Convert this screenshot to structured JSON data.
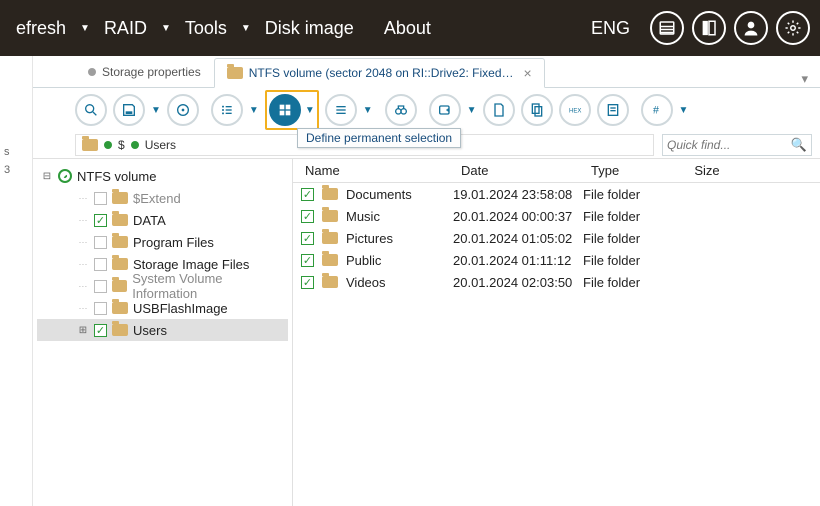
{
  "menubar": {
    "items": [
      "efresh",
      "RAID",
      "Tools",
      "Disk image",
      "About"
    ],
    "lang": "ENG"
  },
  "tabs": {
    "inactive_label": "Storage properties",
    "active_label": "NTFS volume (sector 2048 on RI::Drive2: Fixed…"
  },
  "tooltip": "Define permanent selection",
  "crumb": {
    "sep": "$",
    "tail": "Users"
  },
  "quickfind_placeholder": "Quick find...",
  "tree": {
    "root": "NTFS volume",
    "items": [
      {
        "label": "$Extend",
        "grey": true
      },
      {
        "label": "DATA",
        "checked": true
      },
      {
        "label": "Program Files"
      },
      {
        "label": "Storage Image Files"
      },
      {
        "label": "System Volume Information",
        "grey": true
      },
      {
        "label": "USBFlashImage"
      },
      {
        "label": "Users",
        "selected": true,
        "checked": true,
        "expandable": true
      }
    ]
  },
  "listing": {
    "headers": {
      "name": "Name",
      "date": "Date",
      "type": "Type",
      "size": "Size"
    },
    "rows": [
      {
        "name": "Documents",
        "date": "19.01.2024 23:58:08",
        "type": "File folder"
      },
      {
        "name": "Music",
        "date": "20.01.2024 00:00:37",
        "type": "File folder"
      },
      {
        "name": "Pictures",
        "date": "20.01.2024 01:05:02",
        "type": "File folder"
      },
      {
        "name": "Public",
        "date": "20.01.2024 01:11:12",
        "type": "File folder"
      },
      {
        "name": "Videos",
        "date": "20.01.2024 02:03:50",
        "type": "File folder"
      }
    ]
  }
}
